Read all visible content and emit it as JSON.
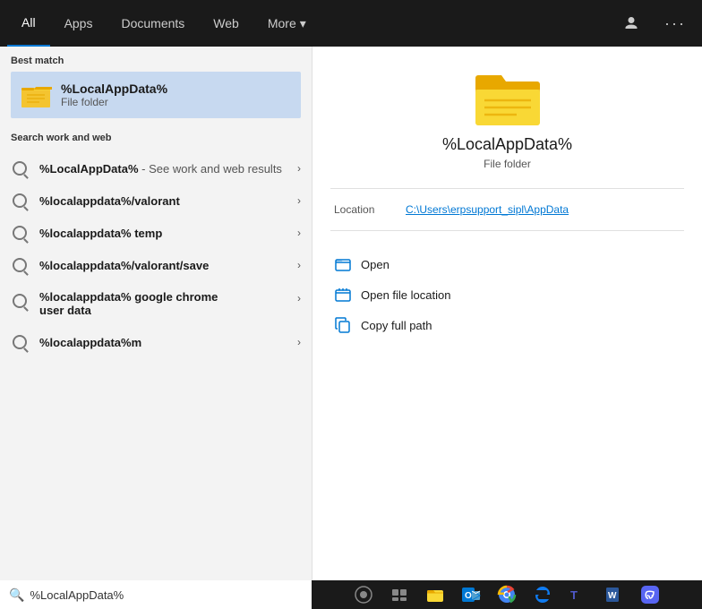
{
  "nav": {
    "tabs": [
      {
        "id": "all",
        "label": "All",
        "active": true
      },
      {
        "id": "apps",
        "label": "Apps",
        "active": false
      },
      {
        "id": "documents",
        "label": "Documents",
        "active": false
      },
      {
        "id": "web",
        "label": "Web",
        "active": false
      },
      {
        "id": "more",
        "label": "More",
        "active": false
      }
    ],
    "more_chevron": "▾"
  },
  "best_match": {
    "section_label": "Best match",
    "title": "%LocalAppData%",
    "subtitle": "File folder"
  },
  "search_work_web": {
    "section_label": "Search work and web",
    "results": [
      {
        "text_bold": "%LocalAppData%",
        "text_dim": " - See work and web results",
        "id": "r1"
      },
      {
        "text_bold": "%localappdata%/valorant",
        "text_dim": "",
        "id": "r2"
      },
      {
        "text_bold": "%localappdata% temp",
        "text_dim": "",
        "id": "r3"
      },
      {
        "text_bold": "%localappdata%/valorant/save",
        "text_dim": "",
        "id": "r4"
      },
      {
        "text_bold": "%localappdata% google chrome user data",
        "text_dim": "",
        "id": "r5",
        "multiline": true,
        "line1": "%localappdata% google chrome",
        "line2": "user data"
      },
      {
        "text_bold": "%localappdata%m",
        "text_dim": "",
        "id": "r6"
      }
    ]
  },
  "right_panel": {
    "title": "%LocalAppData%",
    "subtitle": "File folder",
    "location_label": "Location",
    "location_value": "C:\\Users\\erpsupport_sipl\\AppData",
    "actions": [
      {
        "id": "open",
        "label": "Open"
      },
      {
        "id": "open-file-location",
        "label": "Open file location"
      },
      {
        "id": "copy-full-path",
        "label": "Copy full path"
      }
    ]
  },
  "taskbar": {
    "search_text": "%LocalAppData%",
    "search_placeholder": "%LocalAppData%"
  }
}
